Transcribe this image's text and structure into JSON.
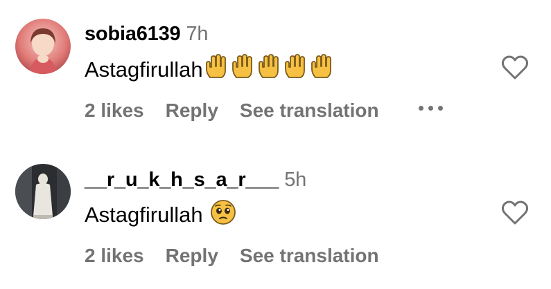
{
  "comments": [
    {
      "username": "sobia6139",
      "time": "7h",
      "text": "Astagfirullah",
      "emojis": [
        "raised-hand",
        "raised-hand",
        "raised-hand",
        "raised-hand",
        "raised-hand"
      ],
      "likes": "2 likes",
      "reply": "Reply",
      "translate": "See translation"
    },
    {
      "username": "__r_u_k_h_s_a_r___",
      "time": "5h",
      "text": "Astagfirullah",
      "emojis": [
        "pleading-face"
      ],
      "likes": "2 likes",
      "reply": "Reply",
      "translate": "See translation"
    }
  ],
  "colors": {
    "secondary_text": "#737373",
    "emoji_yellow": "#F6C142"
  }
}
